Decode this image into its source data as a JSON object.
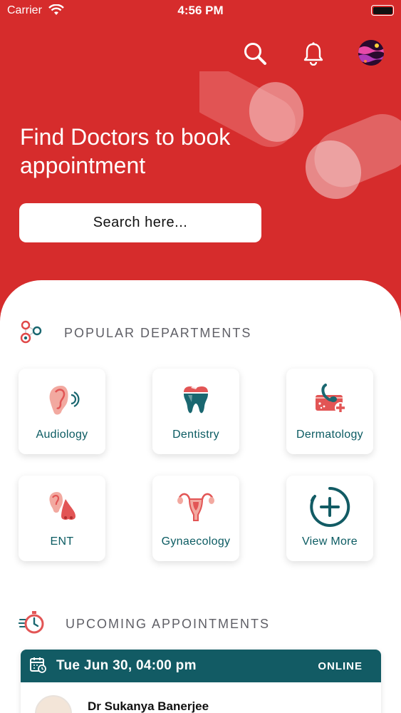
{
  "status_bar": {
    "carrier": "Carrier",
    "time": "4:56 PM"
  },
  "header": {
    "icons": [
      "search-icon",
      "bell-icon",
      "profile-avatar"
    ]
  },
  "hero": {
    "title": "Find Doctors to book appointment",
    "search_placeholder": "Search here..."
  },
  "departments": {
    "section_title": "POPULAR DEPARTMENTS",
    "items": [
      {
        "label": "Audiology",
        "icon": "ear-icon"
      },
      {
        "label": "Dentistry",
        "icon": "tooth-icon"
      },
      {
        "label": "Dermatology",
        "icon": "skin-icon"
      },
      {
        "label": "ENT",
        "icon": "ear-nose-icon"
      },
      {
        "label": "Gynaecology",
        "icon": "uterus-icon"
      },
      {
        "label": "View More",
        "icon": "plus-circle-icon"
      }
    ]
  },
  "appointments": {
    "section_title": "UPCOMING APPOINTMENTS",
    "items": [
      {
        "date": "Tue Jun 30, 04:00 pm",
        "mode": "ONLINE",
        "doctor": "Dr Sukanya Banerjee"
      }
    ]
  },
  "colors": {
    "brand_red": "#d62c2c",
    "teal": "#125b64",
    "text_teal": "#0b5b62"
  }
}
